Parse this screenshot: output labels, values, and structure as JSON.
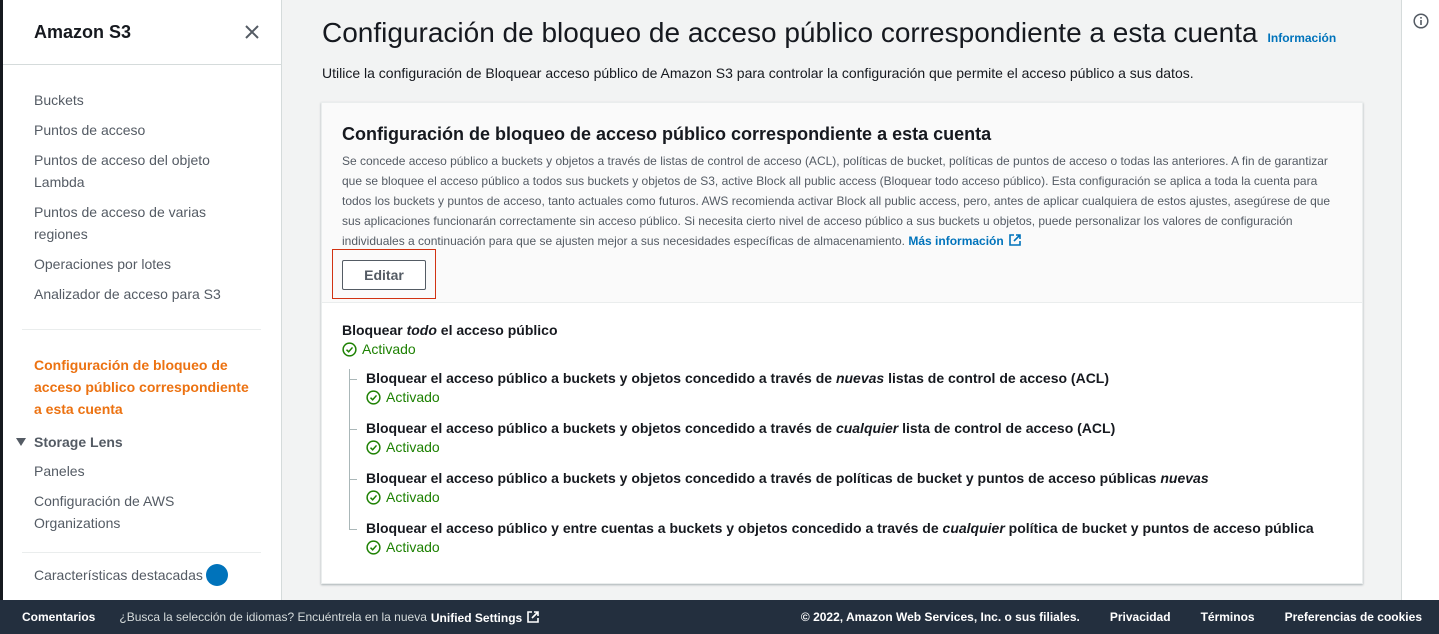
{
  "sidebar": {
    "title": "Amazon S3",
    "items": [
      {
        "label": "Buckets"
      },
      {
        "label": "Puntos de acceso"
      },
      {
        "label": "Puntos de acceso del objeto Lambda"
      },
      {
        "label": "Puntos de acceso de varias regiones"
      },
      {
        "label": "Operaciones por lotes"
      },
      {
        "label": "Analizador de acceso para S3"
      }
    ],
    "active_item": "Configuración de bloqueo de acceso público correspondiente a esta cuenta",
    "section": {
      "label": "Storage Lens",
      "items": [
        {
          "label": "Paneles"
        },
        {
          "label": "Configuración de AWS Organizations"
        }
      ]
    },
    "cut_item": "Características destacadas"
  },
  "main": {
    "title": "Configuración de bloqueo de acceso público correspondiente a esta cuenta",
    "info_link": "Información",
    "description": "Utilice la configuración de Bloquear acceso público de Amazon S3 para controlar la configuración que permite el acceso público a sus datos."
  },
  "card": {
    "title": "Configuración de bloqueo de acceso público correspondiente a esta cuenta",
    "description": "Se concede acceso público a buckets y objetos a través de listas de control de acceso (ACL), políticas de bucket, políticas de puntos de acceso o todas las anteriores. A fin de garantizar que se bloquee el acceso público a todos sus buckets y objetos de S3, active Block all public access (Bloquear todo acceso público). Esta configuración se aplica a toda la cuenta para todos los buckets y puntos de acceso, tanto actuales como futuros. AWS recomienda activar Block all public access, pero, antes de aplicar cualquiera de estos ajustes, asegúrese de que sus aplicaciones funcionarán correctamente sin acceso público. Si necesita cierto nivel de acceso público a sus buckets u objetos, puede personalizar los valores de configuración individuales a continuación para que se ajusten mejor a sus necesidades específicas de almacenamiento.",
    "more_info": "Más información",
    "edit_label": "Editar",
    "main_setting": {
      "pre": "Bloquear ",
      "em": "todo",
      "post": " el acceso público",
      "status": "Activado"
    },
    "sub_settings": [
      {
        "pre": "Bloquear el acceso público a buckets y objetos concedido a través de ",
        "em": "nuevas",
        "post": " listas de control de acceso (ACL)",
        "status": "Activado"
      },
      {
        "pre": "Bloquear el acceso público a buckets y objetos concedido a través de ",
        "em": "cualquier",
        "post": " lista de control de acceso (ACL)",
        "status": "Activado"
      },
      {
        "pre": "Bloquear el acceso público a buckets y objetos concedido a través de políticas de bucket y puntos de acceso públicas ",
        "em": "nuevas",
        "post": "",
        "status": "Activado"
      },
      {
        "pre": "Bloquear el acceso público y entre cuentas a buckets y objetos concedido a través de ",
        "em": "cualquier",
        "post": " política de bucket y puntos de acceso pública",
        "status": "Activado"
      }
    ]
  },
  "footer": {
    "feedback": "Comentarios",
    "lang_prompt": "¿Busca la selección de idiomas? Encuéntrela en la nueva",
    "unified_settings": "Unified Settings",
    "copyright": "© 2022, Amazon Web Services, Inc. o sus filiales.",
    "privacy": "Privacidad",
    "terms": "Términos",
    "cookies": "Preferencias de cookies"
  },
  "icons": {
    "close": "close-icon",
    "caret": "caret-down-icon",
    "external": "external-link-icon",
    "check": "check-circle-icon",
    "info": "info-icon"
  },
  "colors": {
    "accent": "#ec7211",
    "link": "#0073bb",
    "success": "#1d8102",
    "footer_bg": "#232f3e",
    "highlight": "#d13212"
  }
}
